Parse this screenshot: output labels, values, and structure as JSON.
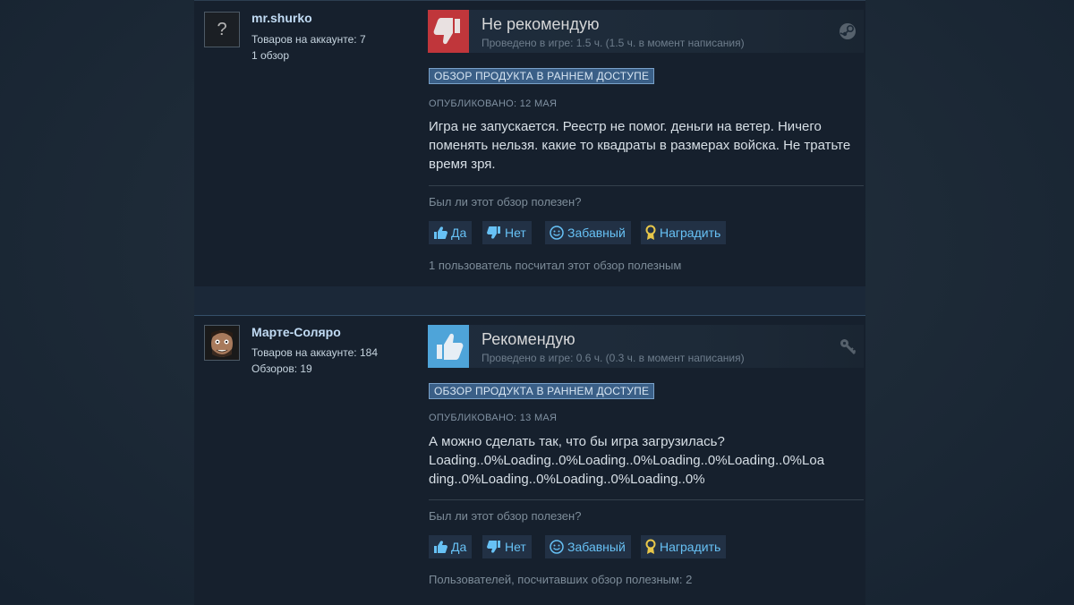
{
  "reviews": [
    {
      "user": {
        "name": "mr.shurko",
        "avatar": "question-mark",
        "products_label": "Товаров на аккаунте: 7",
        "reviews_label": "1 обзор"
      },
      "verdict": "Не рекомендую",
      "verdict_color": "#c0363b",
      "hours": "Проведено в игре: 1.5 ч. (1.5 ч. в момент написания)",
      "corner_icon": "steam-icon",
      "badge": "ОБЗОР ПРОДУКТА В РАННЕМ ДОСТУПЕ",
      "posted": "ОПУБЛИКОВАНО: 12 МАЯ",
      "text": "Игра не запускается. Реестр не помог. деньги на ветер. Ничего поменять нельзя. какие то квадраты в размерах войска. Не тратьте время зря.",
      "question": "Был ли этот обзор полезен?",
      "buttons": {
        "yes": "Да",
        "no": "Нет",
        "funny": "Забавный",
        "award": "Наградить"
      },
      "footer": "1 пользователь посчитал этот обзор полезным"
    },
    {
      "user": {
        "name": "Марте-Соляро",
        "avatar": "user-photo",
        "products_label": "Товаров на аккаунте: 184",
        "reviews_label": "Обзоров: 19"
      },
      "verdict": "Рекомендую",
      "verdict_color": "#4ea4d9",
      "hours": "Проведено в игре: 0.6 ч. (0.3 ч. в момент написания)",
      "corner_icon": "key-icon",
      "badge": "ОБЗОР ПРОДУКТА В РАННЕМ ДОСТУПЕ",
      "posted": "ОПУБЛИКОВАНО: 13 МАЯ",
      "text_lines": [
        "А можно сделать так, что бы игра загрузилась?",
        "Loading..0%Loading..0%Loading..0%Loading..0%Loading..0%Loa",
        "ding..0%Loading..0%Loading..0%Loading..0%"
      ],
      "question": "Был ли этот обзор полезен?",
      "buttons": {
        "yes": "Да",
        "no": "Нет",
        "funny": "Забавный",
        "award": "Наградить"
      },
      "footer": "Пользователей, посчитавших обзор полезным: 2"
    }
  ]
}
